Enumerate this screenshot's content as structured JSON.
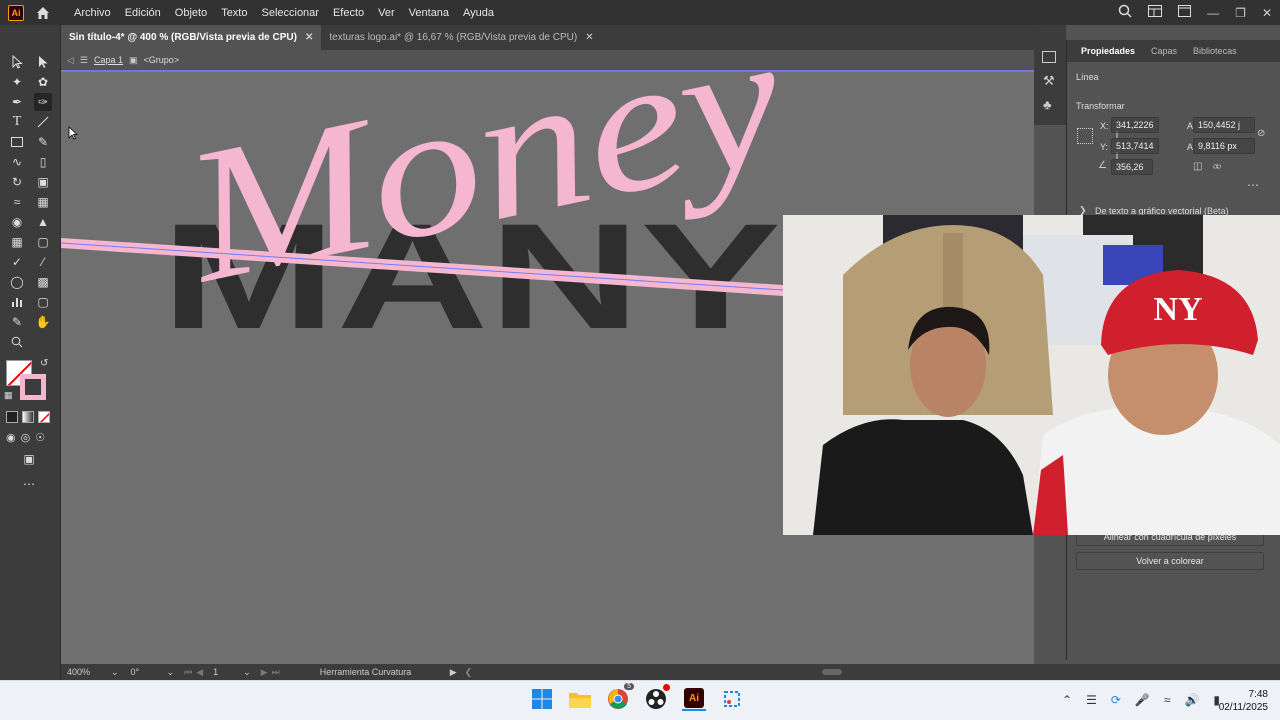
{
  "menu": {
    "logo": "Ai",
    "items": [
      "Archivo",
      "Edición",
      "Objeto",
      "Texto",
      "Seleccionar",
      "Efecto",
      "Ver",
      "Ventana",
      "Ayuda"
    ]
  },
  "tabs": [
    {
      "label": "Sin título-4* @ 400 % (RGB/Vista previa de CPU)",
      "active": true
    },
    {
      "label": "texturas logo.ai* @ 16,67 % (RGB/Vista previa de CPU)",
      "active": false
    }
  ],
  "breadcrumb": {
    "layer": "Capa 1",
    "group": "<Grupo>"
  },
  "artwork": {
    "script_word": "Money",
    "block_word": "MANY",
    "script_color": "#f5b6cf",
    "block_color": "#2e2e2e"
  },
  "properties": {
    "tabs": [
      "Propiedades",
      "Capas",
      "Bibliotecas"
    ],
    "section_line": "Línea",
    "section_transform": "Transformar",
    "x_label": "X:",
    "x_value": "341,2226 j",
    "w_label": "An.:",
    "w_value": "150,4452 j",
    "y_label": "Y:",
    "y_value": "513,7414 j",
    "h_label": "Al.:",
    "h_value": "9,8116 px",
    "angle_value": "356,26",
    "vector_text": "De texto a gráfico vectorial (Beta)",
    "align_button": "Alinear con cuadrícula de píxeles",
    "recolor_button": "Volver a colorear"
  },
  "status": {
    "zoom": "400%",
    "rotation": "0°",
    "page": "1",
    "tool": "Herramienta Curvatura"
  },
  "taskbar": {
    "time": "7:48",
    "date": "02/11/2025",
    "chrome_badge": "5"
  },
  "colors": {
    "accent": "#ff9a00",
    "canvas": "#6f6f6f",
    "pink": "#f5b6cf",
    "webcam_cap": "#d1202d"
  }
}
